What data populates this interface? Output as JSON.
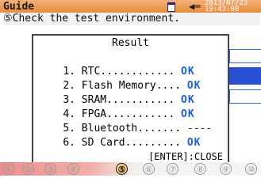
{
  "titlebar": {
    "title": "Guide",
    "datetime": "2013/07/23\n19:43:08"
  },
  "step_text": "⑤Check the test environment.",
  "dialog": {
    "title": "Result",
    "rows": [
      {
        "label": "1. RTC............ ",
        "status": "OK"
      },
      {
        "label": "2. Flash Memory.... ",
        "status": "OK"
      },
      {
        "label": "3. SRAM........... ",
        "status": "OK"
      },
      {
        "label": "4. FPGA........... ",
        "status": "OK"
      },
      {
        "label": "5. Bluetooth....... ",
        "status": "----"
      },
      {
        "label": "6. SD Card......... ",
        "status": "OK"
      }
    ],
    "close_label": "[ENTER]:CLOSE"
  },
  "steps": [
    "①",
    "②",
    "③",
    "④",
    "⑤",
    "⑥",
    "⑦",
    "⑧",
    "⑨",
    "⑩"
  ],
  "current_step": 5,
  "colors": {
    "titlebar": "#e98c3e",
    "ok": "#1d5ed8",
    "accent": "#2a4fd0"
  }
}
